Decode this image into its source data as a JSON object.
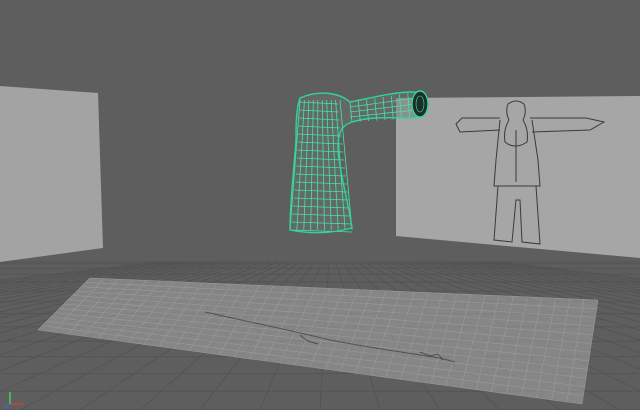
{
  "viewport": {
    "background": "#5e5e5e",
    "selection_wireframe_color": "#49e2a8",
    "ground_grid": "on",
    "view_axis_gizmo": "axis-gizmo-icon"
  },
  "scene": {
    "reference_planes": [
      "side-view-plane",
      "front-view-plane",
      "top-view-plane"
    ],
    "front_reference": "character-front-t-pose-sketch",
    "top_reference": "character-top-view-sketch",
    "selected_mesh": "sleeve-torso-mesh"
  }
}
